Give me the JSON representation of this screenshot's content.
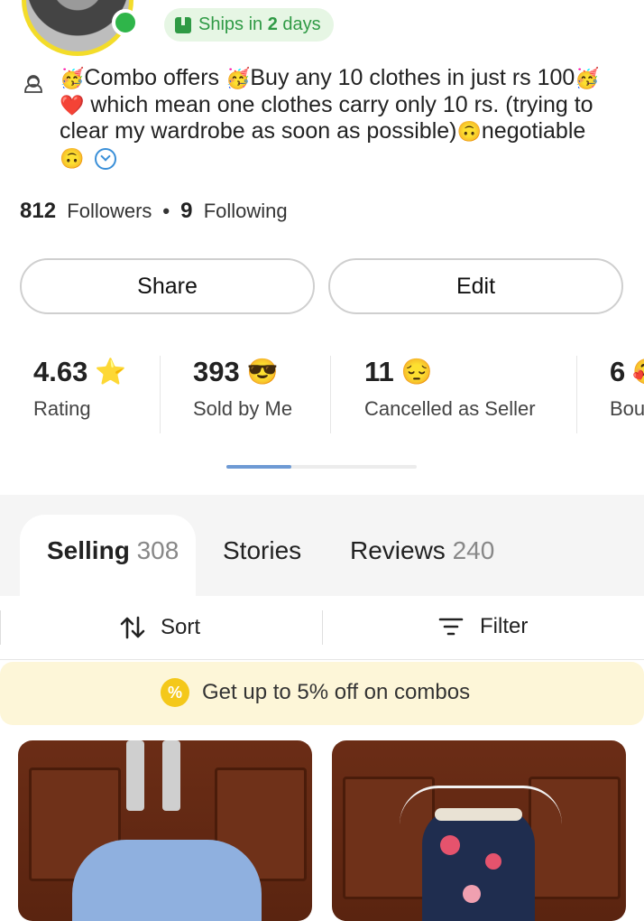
{
  "profile": {
    "ships_label_prefix": "Ships in",
    "ships_days": "2",
    "ships_label_suffix": "days",
    "bio": {
      "line1_a": "Combo offers",
      "line1_b": "Buy any 10 clothes in just rs 100",
      "line2": "which mean one clothes carry only 10 rs. (trying to",
      "line3": "clear  my wardrobe as soon as possible)",
      "line3_tail": "negotiable"
    },
    "followers_count": "812",
    "followers_label": "Followers",
    "following_count": "9",
    "following_label": "Following",
    "separator": "•"
  },
  "actions": {
    "share_label": "Share",
    "edit_label": "Edit"
  },
  "stats": [
    {
      "value": "4.63",
      "label": "Rating",
      "icon": "star-icon"
    },
    {
      "value": "393",
      "label": "Sold by Me",
      "icon": "sunglasses-face-icon"
    },
    {
      "value": "11",
      "label": "Cancelled as Seller",
      "icon": "pensive-face-icon"
    },
    {
      "value": "6",
      "label": "Bou",
      "icon": "emoji-icon"
    }
  ],
  "tabs": [
    {
      "label": "Selling",
      "count": "308",
      "active": true
    },
    {
      "label": "Stories",
      "count": ""
    },
    {
      "label": "Reviews",
      "count": "240"
    }
  ],
  "toolbar": {
    "sort_label": "Sort",
    "filter_label": "Filter"
  },
  "promo": {
    "text": "Get up to 5% off on combos",
    "icon_glyph": "%"
  },
  "emojis": {
    "party": "🥳",
    "heart": "❤️",
    "upside_down": "🙃",
    "star": "⭐",
    "sunglasses": "😎",
    "pensive": "😔",
    "partial": "🥰"
  },
  "colors": {
    "online": "#2fb54a",
    "ships_bg": "#e6f6e4",
    "ships_text": "#2f9a45",
    "accent_blue": "#6e9ad4",
    "promo_bg": "#fdf6d8",
    "promo_badge": "#f4c81a"
  }
}
